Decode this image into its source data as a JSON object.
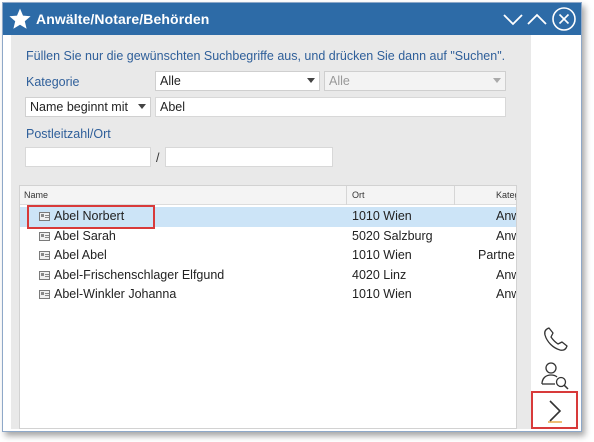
{
  "window": {
    "title": "Anwälte/Notare/Behörden"
  },
  "form": {
    "hint": "Füllen Sie nur die gewünschten Suchbegriffe aus, und drücken Sie dann auf \"Suchen\".",
    "kategorie_label": "Kategorie",
    "kategorie_value": "Alle",
    "subkategorie_value": "Alle",
    "name_mode": "Name beginnt mit",
    "name_value": "Abel",
    "plz_ort_label": "Postleitzahl/Ort",
    "plz_value": "",
    "ort_value": "",
    "separator": "/"
  },
  "list": {
    "columns": [
      "Name",
      "Ort",
      "Kateg"
    ],
    "rows": [
      {
        "name": "Abel Norbert",
        "ort": "1010 Wien",
        "kat": "Anw",
        "selected": true
      },
      {
        "name": "Abel Sarah",
        "ort": "5020 Salzburg",
        "kat": "Anw"
      },
      {
        "name": "Abel Abel",
        "ort": "1010 Wien",
        "kat": "Partne"
      },
      {
        "name": "Abel-Frischenschlager Elfgund",
        "ort": "4020 Linz",
        "kat": "Anw"
      },
      {
        "name": "Abel-Winkler Johanna",
        "ort": "1010 Wien",
        "kat": "Anw"
      }
    ]
  },
  "colors": {
    "titlebar": "#2d6ba7",
    "selection": "#cce4f7",
    "highlight": "#d83a3a",
    "label": "#2f5f9a"
  },
  "icons": {
    "title": "star-icon",
    "minimize": "chevron-down-icon",
    "maximize": "chevron-up-icon",
    "close": "close-circle-icon",
    "phone": "phone-icon",
    "person_search": "person-search-icon",
    "next": "chevron-right-icon"
  }
}
